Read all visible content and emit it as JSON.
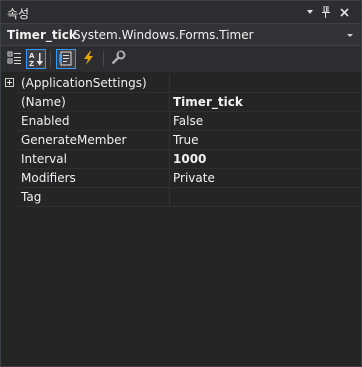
{
  "window": {
    "title": "속성",
    "pin_icon": "pin-icon",
    "close_icon": "close-icon",
    "menu_icon": "window-position-icon"
  },
  "selector": {
    "object_name": "Timer_tick",
    "object_type": "System.Windows.Forms.Timer"
  },
  "toolbar": {
    "buttons": [
      {
        "icon": "categorized-icon",
        "active": false
      },
      {
        "icon": "alphabetical-icon",
        "active": true
      },
      {
        "icon": "properties-icon",
        "active": true
      },
      {
        "icon": "events-icon",
        "active": false
      },
      {
        "icon": "property-pages-icon",
        "active": false
      }
    ]
  },
  "grid": {
    "rows": [
      {
        "name": "(ApplicationSettings)",
        "value": "",
        "expandable": true
      },
      {
        "name": "(Name)",
        "value": "Timer_tick",
        "bold": true
      },
      {
        "name": "Enabled",
        "value": "False",
        "bold": false
      },
      {
        "name": "GenerateMember",
        "value": "True",
        "bold": false
      },
      {
        "name": "Interval",
        "value": "1000",
        "bold": true
      },
      {
        "name": "Modifiers",
        "value": "Private",
        "bold": false
      },
      {
        "name": "Tag",
        "value": "",
        "bold": false
      }
    ]
  },
  "colors": {
    "background": "#252526",
    "accent": "#3399ff",
    "text": "#f1f1f1"
  }
}
